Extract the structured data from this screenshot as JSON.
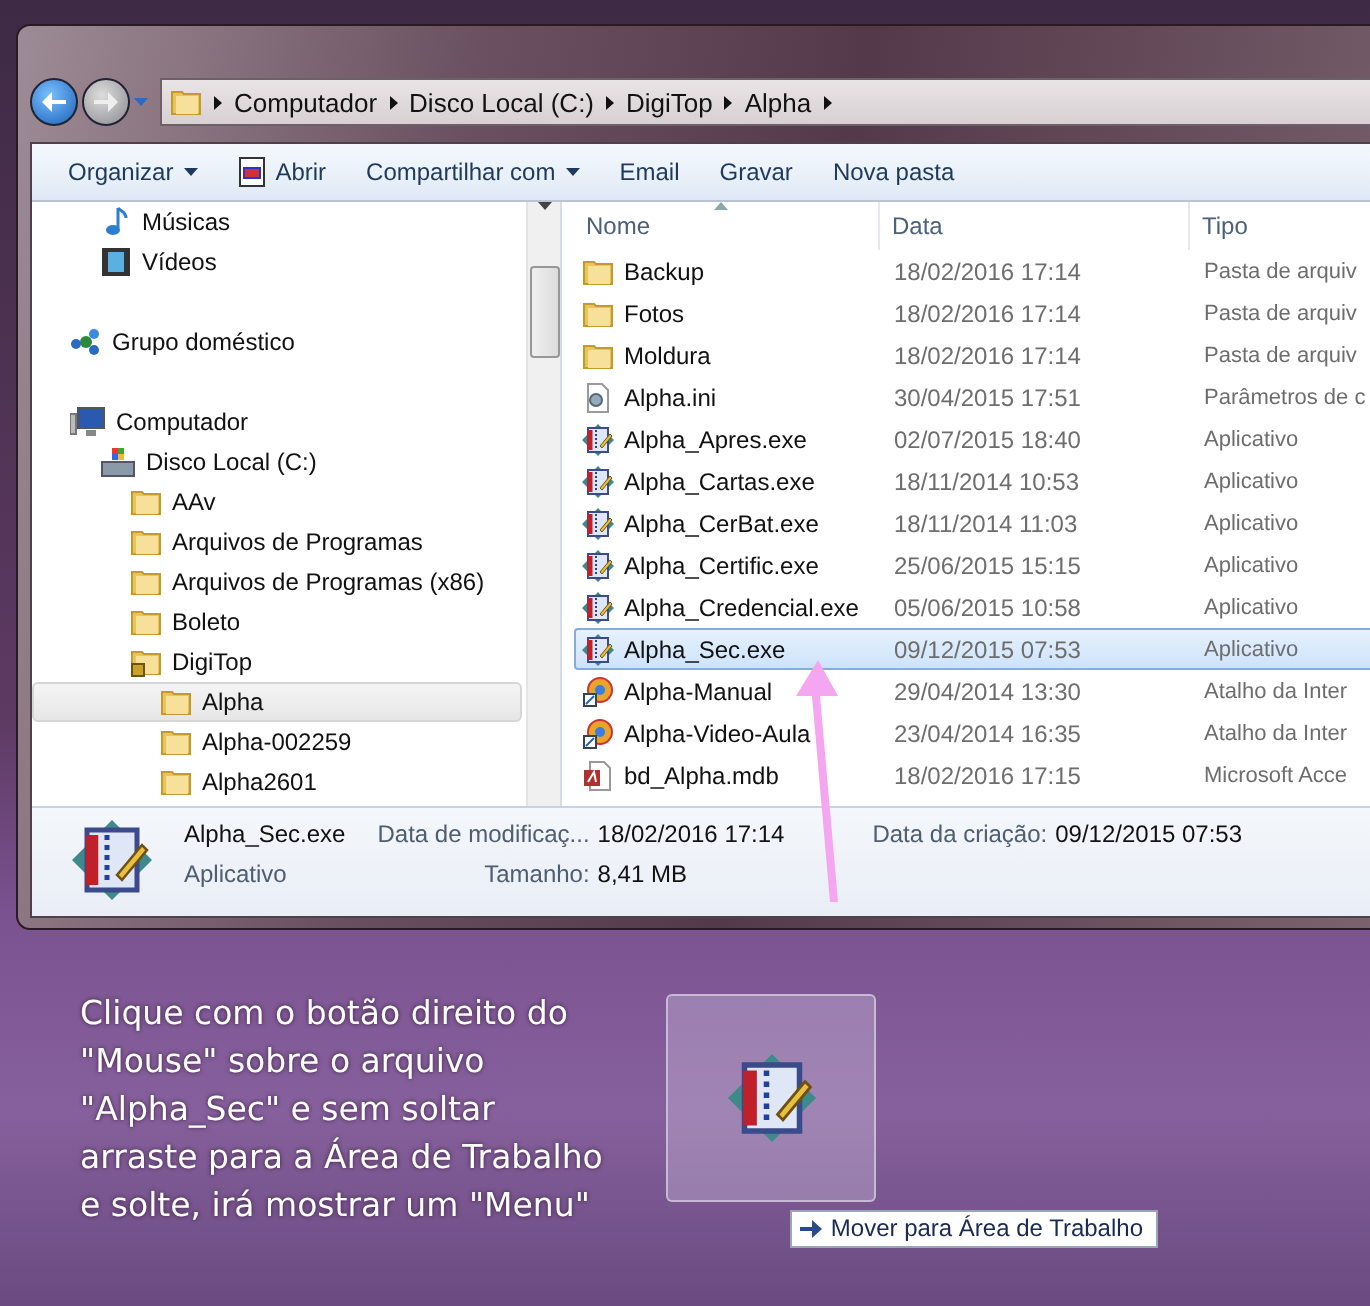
{
  "address_bar": {
    "breadcrumb": [
      "Computador",
      "Disco Local (C:)",
      "DigiTop",
      "Alpha"
    ]
  },
  "toolbar": [
    {
      "label": "Organizar",
      "kind": "menu"
    },
    {
      "label": "Abrir",
      "kind": "icon"
    },
    {
      "label": "Compartilhar com",
      "kind": "menu"
    },
    {
      "label": "Email",
      "kind": "plain"
    },
    {
      "label": "Gravar",
      "kind": "plain"
    },
    {
      "label": "Nova pasta",
      "kind": "plain"
    }
  ],
  "navigation": {
    "libraries": [
      {
        "label": "Músicas",
        "kind": "music",
        "selected": false
      },
      {
        "label": "Vídeos",
        "kind": "video",
        "selected": false
      }
    ],
    "homegroup": {
      "label": "Grupo doméstico",
      "kind": "homegroup",
      "selected": false
    },
    "computer": {
      "label": "Computador",
      "kind": "computer",
      "selected": false,
      "children": [
        {
          "label": "Disco Local (C:)",
          "kind": "drive",
          "selected": false,
          "children": [
            {
              "label": "AAv",
              "kind": "folder",
              "selected": false
            },
            {
              "label": "Arquivos de Programas",
              "kind": "folder",
              "selected": false
            },
            {
              "label": "Arquivos de Programas (x86)",
              "kind": "folder",
              "selected": false
            },
            {
              "label": "Boleto",
              "kind": "folder",
              "selected": false
            },
            {
              "label": "DigiTop",
              "kind": "locked-folder",
              "selected": false,
              "children": [
                {
                  "label": "Alpha",
                  "kind": "folder",
                  "selected": true
                },
                {
                  "label": "Alpha-002259",
                  "kind": "folder",
                  "selected": false
                },
                {
                  "label": "Alpha2601",
                  "kind": "folder",
                  "selected": false
                }
              ]
            }
          ]
        }
      ]
    }
  },
  "file_list": {
    "columns": [
      "Nome",
      "Data",
      "Tipo"
    ],
    "rows": [
      {
        "name": "Backup",
        "date": "18/02/2016 17:14",
        "type": "Pasta de arquiv",
        "kind": "folder",
        "selected": false
      },
      {
        "name": "Fotos",
        "date": "18/02/2016 17:14",
        "type": "Pasta de arquiv",
        "kind": "folder",
        "selected": false
      },
      {
        "name": "Moldura",
        "date": "18/02/2016 17:14",
        "type": "Pasta de arquiv",
        "kind": "folder",
        "selected": false
      },
      {
        "name": "Alpha.ini",
        "date": "30/04/2015 17:51",
        "type": "Parâmetros de c",
        "kind": "settings",
        "selected": false
      },
      {
        "name": "Alpha_Apres.exe",
        "date": "02/07/2015 18:40",
        "type": "Aplicativo",
        "kind": "app",
        "selected": false
      },
      {
        "name": "Alpha_Cartas.exe",
        "date": "18/11/2014 10:53",
        "type": "Aplicativo",
        "kind": "app",
        "selected": false
      },
      {
        "name": "Alpha_CerBat.exe",
        "date": "18/11/2014 11:03",
        "type": "Aplicativo",
        "kind": "app",
        "selected": false
      },
      {
        "name": "Alpha_Certific.exe",
        "date": "25/06/2015 15:15",
        "type": "Aplicativo",
        "kind": "app",
        "selected": false
      },
      {
        "name": "Alpha_Credencial.exe",
        "date": "05/06/2015 10:58",
        "type": "Aplicativo",
        "kind": "app",
        "selected": false
      },
      {
        "name": "Alpha_Sec.exe",
        "date": "09/12/2015 07:53",
        "type": "Aplicativo",
        "kind": "app",
        "selected": true
      },
      {
        "name": "Alpha-Manual",
        "date": "29/04/2014 13:30",
        "type": "Atalho da Inter",
        "kind": "shortcut",
        "selected": false
      },
      {
        "name": "Alpha-Video-Aula",
        "date": "23/04/2014 16:35",
        "type": "Atalho da Inter",
        "kind": "shortcut",
        "selected": false
      },
      {
        "name": "bd_Alpha.mdb",
        "date": "18/02/2016 17:15",
        "type": "Microsoft Acce",
        "kind": "database",
        "selected": false
      }
    ]
  },
  "details_pane": {
    "name": "Alpha_Sec.exe",
    "type": "Aplicativo",
    "fields": [
      {
        "label": "Data de modificaç...",
        "value": "18/02/2016 17:14"
      },
      {
        "label": "Tamanho:",
        "value": "8,41 MB"
      },
      {
        "label": "Data da criação:",
        "value": "09/12/2015 07:53"
      }
    ]
  },
  "desktop": {
    "instruction": "Clique com o botão direito do\n\"Mouse\" sobre o arquivo\n\"Alpha_Sec\" e sem soltar\narraste para a Área de Trabalho\ne solte, irá mostrar um \"Menu\"",
    "drag_tooltip": "Mover para Área de Trabalho"
  }
}
